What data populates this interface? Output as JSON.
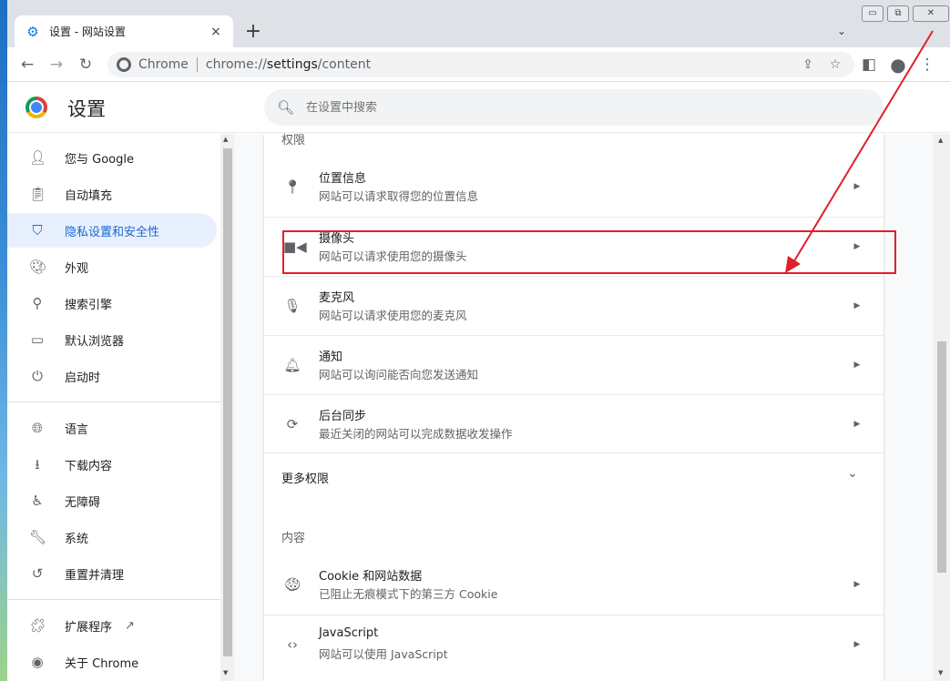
{
  "tab": {
    "favicon": "gear-icon",
    "title": "设置 - 网站设置",
    "close": "×"
  },
  "new_tab": "+",
  "tab_search": "⌄",
  "window_controls": {
    "minimize": "▭",
    "restore": "⧉",
    "close": "✕"
  },
  "toolbar": {
    "back": "←",
    "forward": "→",
    "reload": "↻",
    "site_chip": "Chrome",
    "url_prefix": "chrome://",
    "url_host": "settings",
    "url_path": "/content",
    "share": "⇪",
    "bookmark": "☆",
    "side_panel": "◧",
    "profile": "●",
    "menu": "⋮"
  },
  "header": {
    "title": "设置",
    "search_placeholder": "在设置中搜索"
  },
  "sidebar": {
    "items": [
      {
        "label": "您与 Google",
        "icon": "person-icon"
      },
      {
        "label": "自动填充",
        "icon": "clipboard-icon"
      },
      {
        "label": "隐私设置和安全性",
        "icon": "shield-icon",
        "active": true
      },
      {
        "label": "外观",
        "icon": "palette-icon"
      },
      {
        "label": "搜索引擎",
        "icon": "search-icon"
      },
      {
        "label": "默认浏览器",
        "icon": "browser-icon"
      },
      {
        "label": "启动时",
        "icon": "power-icon"
      },
      {
        "label": "语言",
        "icon": "globe-icon"
      },
      {
        "label": "下载内容",
        "icon": "download-icon"
      },
      {
        "label": "无障碍",
        "icon": "accessibility-icon"
      },
      {
        "label": "系统",
        "icon": "wrench-icon"
      },
      {
        "label": "重置并清理",
        "icon": "restore-icon"
      },
      {
        "label": "扩展程序",
        "icon": "puzzle-icon"
      },
      {
        "label": "关于 Chrome",
        "icon": "chrome-icon"
      }
    ]
  },
  "content": {
    "permissions_title": "权限",
    "permissions": [
      {
        "title": "位置信息",
        "subtitle": "网站可以请求取得您的位置信息",
        "icon": "location-pin-icon"
      },
      {
        "title": "摄像头",
        "subtitle": "网站可以请求使用您的摄像头",
        "icon": "camera-icon"
      },
      {
        "title": "麦克风",
        "subtitle": "网站可以请求使用您的麦克风",
        "icon": "microphone-icon"
      },
      {
        "title": "通知",
        "subtitle": "网站可以询问能否向您发送通知",
        "icon": "bell-icon"
      },
      {
        "title": "后台同步",
        "subtitle": "最近关闭的网站可以完成数据收发操作",
        "icon": "sync-icon"
      }
    ],
    "more_permissions": "更多权限",
    "content_title": "内容",
    "content_items": [
      {
        "title": "Cookie 和网站数据",
        "subtitle": "已阻止无痕模式下的第三方 Cookie",
        "icon": "cookie-icon"
      },
      {
        "title": "JavaScript",
        "subtitle": "网站可以使用 JavaScript",
        "icon": "code-icon"
      }
    ]
  },
  "colors": {
    "accent": "#1a73e8",
    "active_bg": "#e8f0fe",
    "annotation": "#e0202a"
  }
}
